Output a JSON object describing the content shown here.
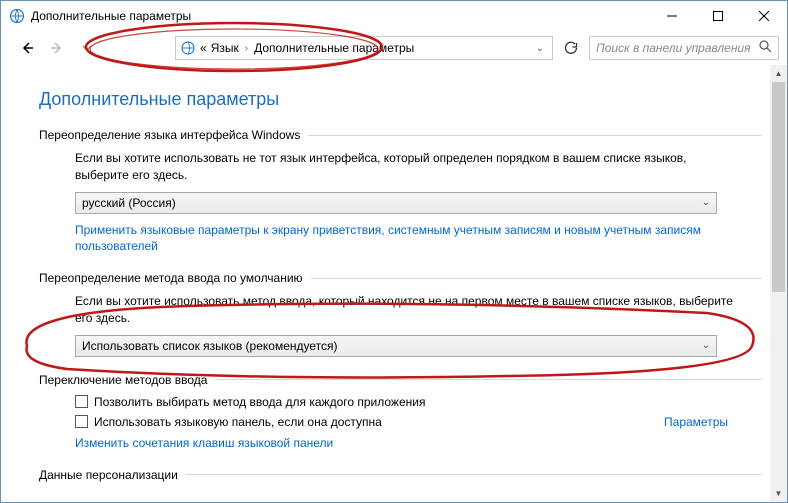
{
  "window": {
    "title": "Дополнительные параметры"
  },
  "breadcrumb": {
    "chevrons": "«",
    "item1": "Язык",
    "item2": "Дополнительные параметры"
  },
  "search": {
    "placeholder": "Поиск в панели управления"
  },
  "page": {
    "title": "Дополнительные параметры"
  },
  "section1": {
    "header": "Переопределение языка интерфейса Windows",
    "desc": "Если вы хотите использовать не тот язык интерфейса, который определен порядком в вашем списке языков, выберите его здесь.",
    "selected": "русский (Россия)",
    "link": "Применить языковые параметры к экрану приветствия, системным учетным записям и новым учетным записям пользователей"
  },
  "section2": {
    "header": "Переопределение метода ввода по умолчанию",
    "desc": "Если вы хотите использовать метод ввода, который находится не на первом месте в вашем списке языков, выберите его здесь.",
    "selected": "Использовать список языков (рекомендуется)"
  },
  "section3": {
    "header": "Переключение методов ввода",
    "cb1": "Позволить выбирать метод ввода для каждого приложения",
    "cb2": "Использовать языковую панель, если она доступна",
    "param_link": "Параметры",
    "link": "Изменить сочетания клавиш языковой панели"
  },
  "section4": {
    "header": "Данные персонализации"
  }
}
